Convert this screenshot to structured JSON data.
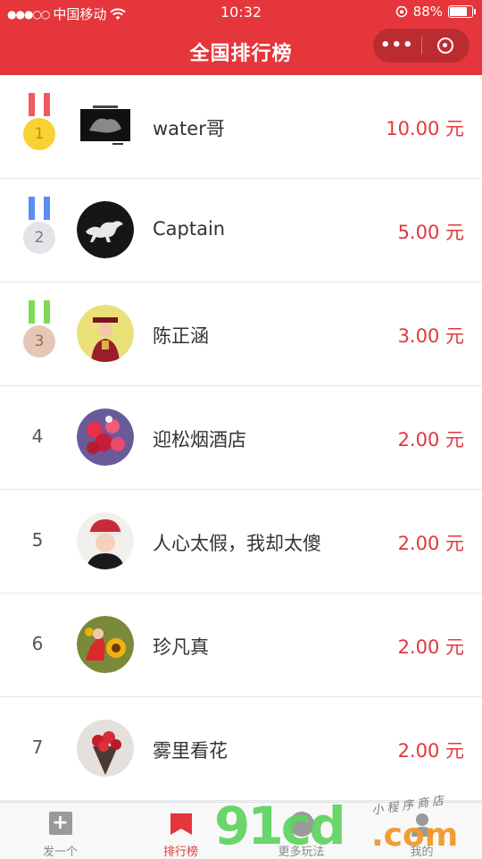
{
  "status_bar": {
    "carrier": "中国移动",
    "time": "10:32",
    "battery": "88%",
    "battery_level": 0.88
  },
  "nav": {
    "title": "全国排行榜"
  },
  "colors": {
    "brand_red": "#e4363b",
    "gold": "#f7d233",
    "silver": "#e3e3e8",
    "bronze": "#e6c7b7",
    "ribbon_red": "#f05a5f",
    "ribbon_blue": "#5a8ef0",
    "ribbon_green": "#7ed957"
  },
  "ranking": [
    {
      "rank": "1",
      "name": "water哥",
      "amount": "10.00 元",
      "medal": "gold"
    },
    {
      "rank": "2",
      "name": "Captain",
      "amount": "5.00 元",
      "medal": "silver"
    },
    {
      "rank": "3",
      "name": "陈正涵",
      "amount": "3.00 元",
      "medal": "bronze"
    },
    {
      "rank": "4",
      "name": "迎松烟酒店",
      "amount": "2.00 元"
    },
    {
      "rank": "5",
      "name": "人心太假，我却太傻",
      "amount": "2.00 元"
    },
    {
      "rank": "6",
      "name": "珍凡真",
      "amount": "2.00 元"
    },
    {
      "rank": "7",
      "name": "雾里看花",
      "amount": "2.00 元"
    }
  ],
  "tab_bar": {
    "tabs": [
      {
        "label": "发一个",
        "icon": "plus-icon"
      },
      {
        "label": "排行榜",
        "icon": "bookmark-icon",
        "active": true
      },
      {
        "label": "更多玩法",
        "icon": "clock-icon"
      },
      {
        "label": "我的",
        "icon": "user-icon"
      }
    ]
  },
  "watermark": {
    "brand": "91cd",
    "domain": ".com",
    "subtitle": "小程序商店"
  }
}
